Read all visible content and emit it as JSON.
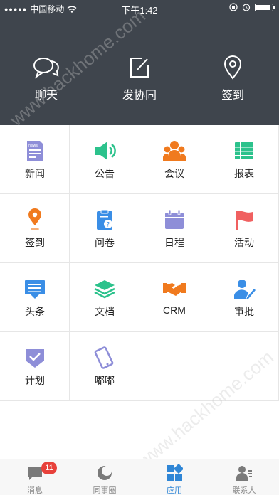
{
  "status_bar": {
    "carrier": "中国移动",
    "time": "下午1:42"
  },
  "quick_actions": [
    {
      "label": "聊天",
      "icon": "chat-bubbles-icon"
    },
    {
      "label": "发协同",
      "icon": "edit-square-icon"
    },
    {
      "label": "签到",
      "icon": "location-pin-icon"
    }
  ],
  "apps": [
    {
      "label": "新闻",
      "icon": "news-icon",
      "color": "#8e8ed8"
    },
    {
      "label": "公告",
      "icon": "speaker-icon",
      "color": "#2cc28c"
    },
    {
      "label": "会议",
      "icon": "meeting-icon",
      "color": "#f07a1e"
    },
    {
      "label": "报表",
      "icon": "report-icon",
      "color": "#2cc28c"
    },
    {
      "label": "签到",
      "icon": "location-pin-icon",
      "color": "#f07a1e"
    },
    {
      "label": "问卷",
      "icon": "survey-icon",
      "color": "#3a8ee6"
    },
    {
      "label": "日程",
      "icon": "calendar-icon",
      "color": "#8e8ed8"
    },
    {
      "label": "活动",
      "icon": "flag-icon",
      "color": "#f06060"
    },
    {
      "label": "头条",
      "icon": "headline-icon",
      "color": "#3a8ee6"
    },
    {
      "label": "文档",
      "icon": "layers-icon",
      "color": "#2cc28c"
    },
    {
      "label": "CRM",
      "icon": "handshake-icon",
      "color": "#f07a1e"
    },
    {
      "label": "审批",
      "icon": "approval-icon",
      "color": "#3a8ee6"
    },
    {
      "label": "计划",
      "icon": "plan-check-icon",
      "color": "#8e8ed8"
    },
    {
      "label": "嘟嘟",
      "icon": "phone-icon",
      "color": "#8e8ed8"
    }
  ],
  "tabs": [
    {
      "label": "消息",
      "icon": "message-icon",
      "badge": "11",
      "active": false
    },
    {
      "label": "同事圈",
      "icon": "colleague-circle-icon",
      "active": false
    },
    {
      "label": "应用",
      "icon": "apps-grid-icon",
      "active": true
    },
    {
      "label": "联系人",
      "icon": "contacts-icon",
      "active": false
    }
  ],
  "watermark": "www.hackhome.com",
  "colors": {
    "header_bg": "#3f454d",
    "active_tab": "#2f86d6",
    "badge": "#e8413b"
  }
}
